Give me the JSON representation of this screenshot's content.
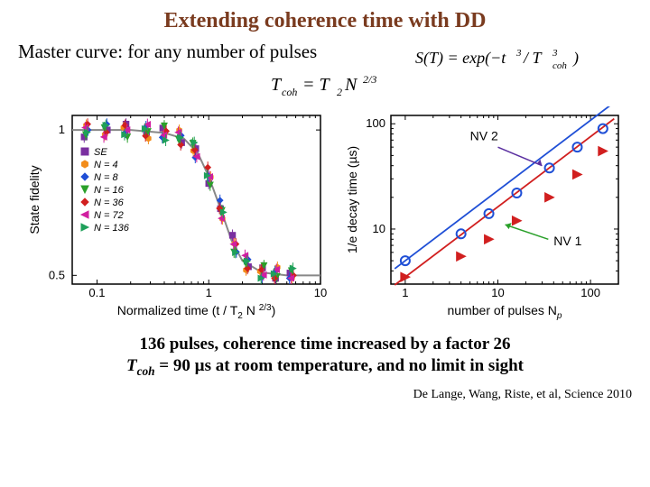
{
  "title": "Extending coherence time with DD",
  "subtitle": "Master curve: for any number of pulses",
  "formula_right": "S(T) = exp(−t³ / T³coh)",
  "formula_center": "Tcoh = T₂ N^{2/3}",
  "chart_data": [
    {
      "type": "scatter",
      "title": "",
      "xlabel": "Normalized time  (t / T₂  N^{2/3})",
      "ylabel": "State fidelity",
      "xlim": [
        0.06,
        10
      ],
      "ylim": [
        0.47,
        1.05
      ],
      "xscale": "log",
      "xticks": [
        0.1,
        1,
        10
      ],
      "yticks": [
        0.5,
        1
      ],
      "legend_title": "",
      "series": [
        {
          "name": "SE",
          "color": "#7a2fa0",
          "marker": "square"
        },
        {
          "name": "N = 4",
          "color": "#f28c1b",
          "marker": "hex"
        },
        {
          "name": "N = 8",
          "color": "#1f4fd6",
          "marker": "diamond"
        },
        {
          "name": "N = 16",
          "color": "#2aa02a",
          "marker": "tri-down"
        },
        {
          "name": "N = 36",
          "color": "#d11f1f",
          "marker": "diamond"
        },
        {
          "name": "N = 72",
          "color": "#d11fa0",
          "marker": "tri-left"
        },
        {
          "name": "N = 136",
          "color": "#1fa05a",
          "marker": "tri-right"
        }
      ],
      "master_curve_x": [
        0.06,
        0.1,
        0.2,
        0.4,
        0.6,
        0.8,
        1.0,
        1.3,
        1.6,
        2.0,
        3.0,
        5.0,
        10.0
      ],
      "master_curve_y": [
        1.0,
        1.0,
        1.0,
        0.99,
        0.97,
        0.92,
        0.84,
        0.72,
        0.62,
        0.55,
        0.51,
        0.5,
        0.5
      ]
    },
    {
      "type": "scatter",
      "title": "",
      "xlabel": "number of pulses Nₚ",
      "ylabel": "1/e decay time (µs)",
      "xlim": [
        0.7,
        200
      ],
      "ylim": [
        3,
        120
      ],
      "xscale": "log",
      "yscale": "log",
      "xticks": [
        1,
        10,
        100
      ],
      "yticks": [
        10,
        100
      ],
      "series": [
        {
          "name": "NV 1",
          "color": "#d11f1f",
          "marker": "tri-right",
          "x": [
            1,
            4,
            8,
            16,
            36,
            72,
            136
          ],
          "y": [
            3.5,
            5.5,
            8,
            12,
            20,
            33,
            55
          ]
        },
        {
          "name": "NV 2",
          "color": "#1f4fd6",
          "marker": "circle-open",
          "x": [
            1,
            4,
            8,
            16,
            36,
            72,
            136
          ],
          "y": [
            5,
            9,
            14,
            22,
            38,
            60,
            90
          ]
        }
      ],
      "fit_exponent": 0.667,
      "annotations": [
        "NV 2",
        "NV 1"
      ]
    }
  ],
  "legend": {
    "items": [
      "SE",
      "N = 4",
      "N = 8",
      "N = 16",
      "N = 36",
      "N = 72",
      "N = 136"
    ]
  },
  "bottom_line_1": "136 pulses, coherence time increased by a factor 26",
  "bottom_line_2a": "T",
  "bottom_line_2b": "coh",
  "bottom_line_2c": " = 90 µs at room temperature, and no limit in sight",
  "citation": "De Lange, Wang, Riste, et al, Science 2010"
}
